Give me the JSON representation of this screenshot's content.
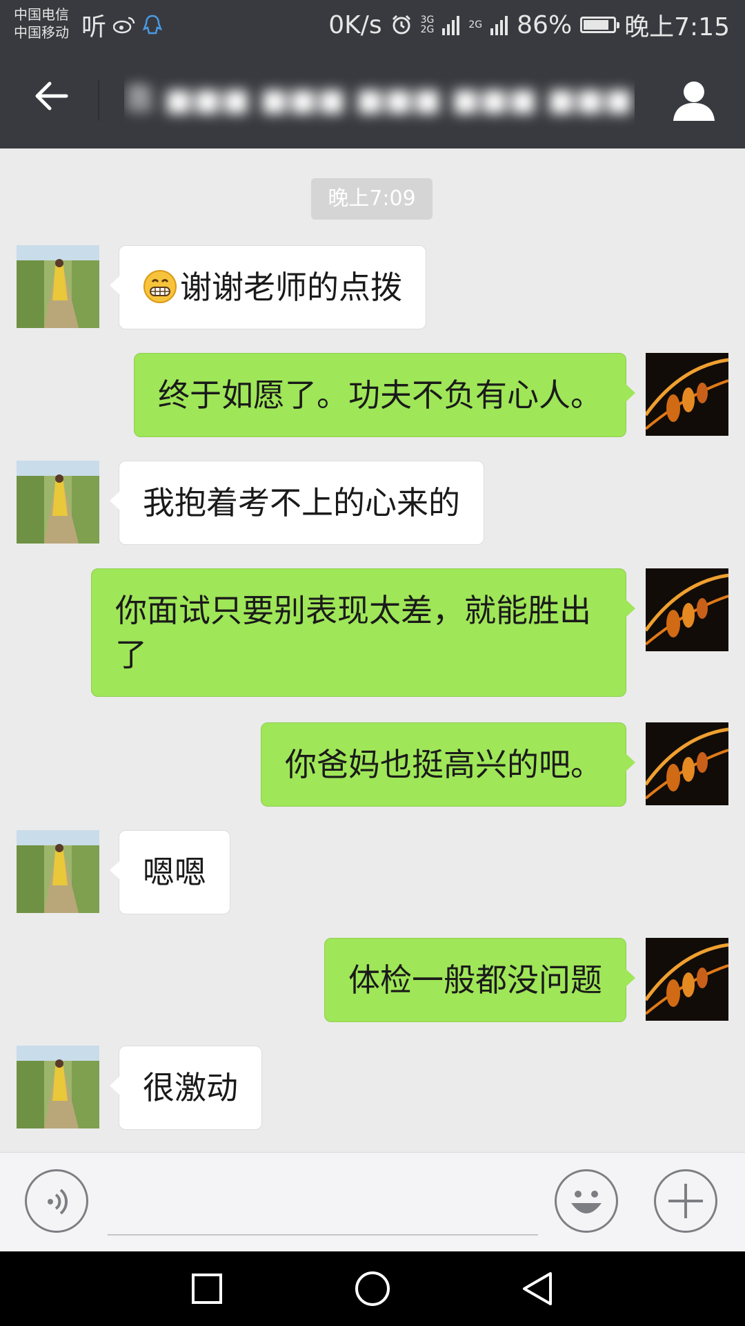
{
  "status_bar": {
    "carrier_1": "中国电信",
    "carrier_2": "中国移动",
    "app_icon_listen": "听",
    "net_speed": "0K/s",
    "signal_1": "3G\n2G",
    "signal_2": "2G",
    "battery_percent": "86%",
    "battery_level": 0.86,
    "time": "晚上7:15"
  },
  "header": {
    "back_icon": "arrow-left-icon",
    "title": "靠 ■■■ ■■■ ■■■ ■■■ ■■■ ia",
    "profile_icon": "person-icon"
  },
  "chat": {
    "timestamp": "晚上7:09",
    "messages": [
      {
        "side": "in",
        "text": "谢谢老师的点拨",
        "emoji": "grinning-face-icon"
      },
      {
        "side": "out",
        "text": "终于如愿了。功夫不负有心人。"
      },
      {
        "side": "in",
        "text": "我抱着考不上的心来的"
      },
      {
        "side": "out",
        "text": "你面试只要别表现太差，就能胜出了"
      },
      {
        "side": "out",
        "text": "你爸妈也挺高兴的吧。"
      },
      {
        "side": "in",
        "text": "嗯嗯"
      },
      {
        "side": "out",
        "text": "体检一般都没问题"
      },
      {
        "side": "in",
        "text": "很激动"
      }
    ]
  },
  "input_bar": {
    "voice_icon": "voice-icon",
    "emoji_icon": "smiley-icon",
    "plus_icon": "plus-icon"
  },
  "nav_bar": {
    "recents_icon": "square-icon",
    "home_icon": "circle-icon",
    "back_icon": "triangle-back-icon"
  },
  "colors": {
    "header_bg": "#393a3f",
    "chat_bg": "#ebebeb",
    "bubble_out": "#9fe658",
    "bubble_in": "#ffffff"
  }
}
